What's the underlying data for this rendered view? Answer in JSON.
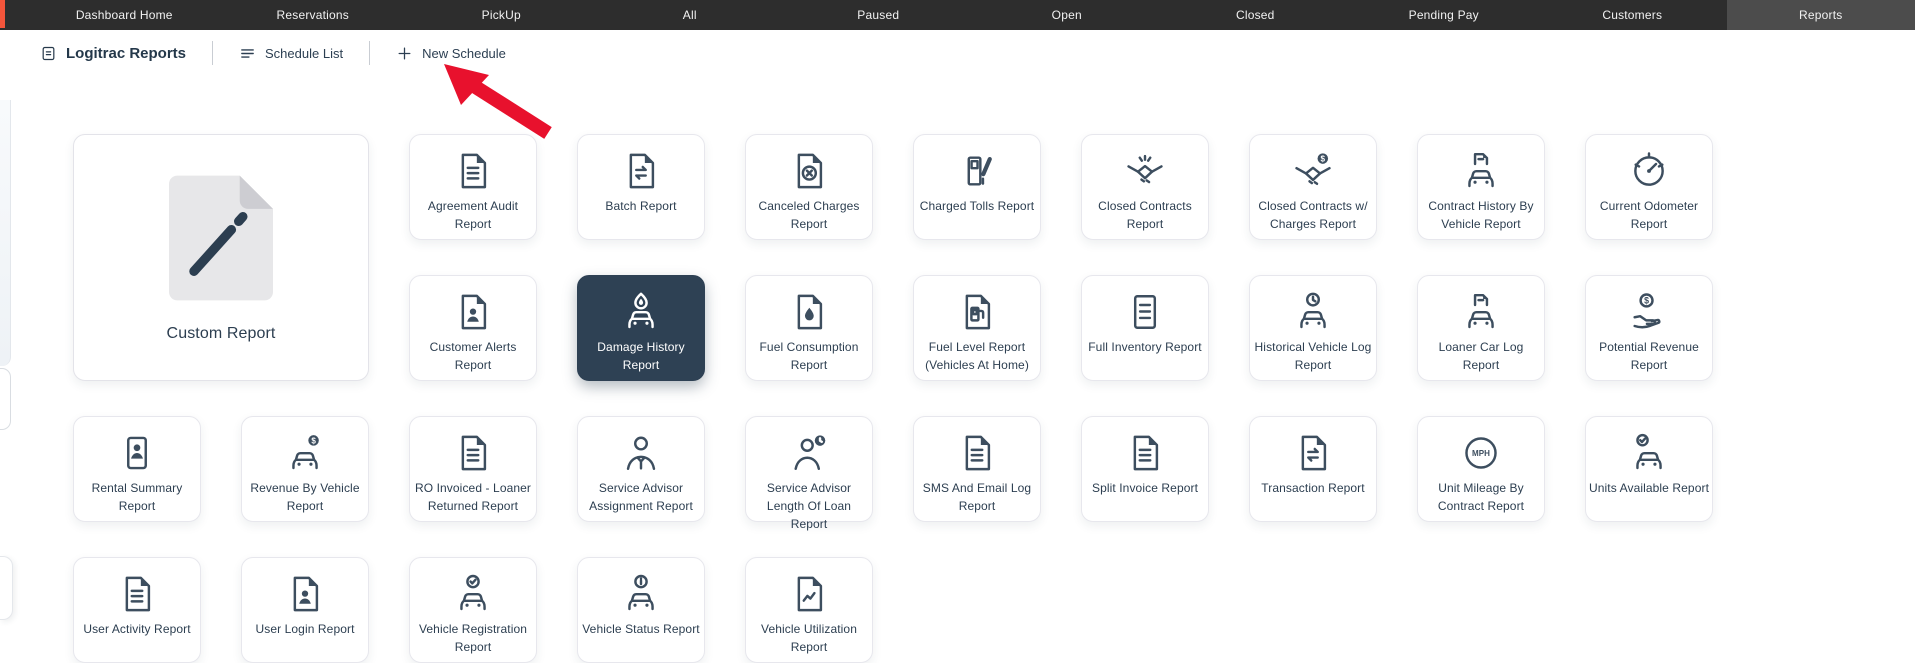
{
  "nav": {
    "items": [
      {
        "label": "Dashboard Home",
        "active": false
      },
      {
        "label": "Reservations",
        "active": false
      },
      {
        "label": "PickUp",
        "active": false
      },
      {
        "label": "All",
        "active": false
      },
      {
        "label": "Paused",
        "active": false
      },
      {
        "label": "Open",
        "active": false
      },
      {
        "label": "Closed",
        "active": false
      },
      {
        "label": "Pending Pay",
        "active": false
      },
      {
        "label": "Customers",
        "active": false
      },
      {
        "label": "Reports",
        "active": true
      }
    ]
  },
  "toolbar": {
    "title": "Logitrac Reports",
    "title_icon": "report-icon",
    "schedule_list_label": "Schedule List",
    "new_schedule_label": "New Schedule",
    "annotation": {
      "shape": "arrow",
      "points_to": "New Schedule",
      "color": "#e8112d"
    }
  },
  "custom_report": {
    "label": "Custom Report",
    "icon": "custom-document"
  },
  "report_rows": [
    [
      {
        "label": "Agreement Audit Report",
        "icon": "doc-lines"
      },
      {
        "label": "Batch Report",
        "icon": "doc-arrows"
      },
      {
        "label": "Canceled Charges Report",
        "icon": "doc-x"
      },
      {
        "label": "Charged Tolls Report",
        "icon": "toll-booth"
      },
      {
        "label": "Closed Contracts Report",
        "icon": "handshake"
      },
      {
        "label": "Closed Contracts w/ Charges Report",
        "icon": "handshake-dollar"
      },
      {
        "label": "Contract History By Vehicle Report",
        "icon": "car-document"
      },
      {
        "label": "Current Odometer Report",
        "icon": "odometer-gauge"
      }
    ],
    [
      {
        "label": "Customer Alerts Report",
        "icon": "doc-person"
      },
      {
        "label": "Damage History Report",
        "icon": "car-flame",
        "selected": true
      },
      {
        "label": "Fuel Consumption Report",
        "icon": "doc-droplet"
      },
      {
        "label": "Fuel Level Report (Vehicles At Home)",
        "icon": "doc-fuel-pump"
      },
      {
        "label": "Full Inventory Report",
        "icon": "doc-lines-boxed"
      },
      {
        "label": "Historical Vehicle Log Report",
        "icon": "car-clock"
      },
      {
        "label": "Loaner Car Log Report",
        "icon": "car-document"
      },
      {
        "label": "Potential Revenue Report",
        "icon": "hand-coin"
      }
    ],
    [
      {
        "label": "Rental Summary Report",
        "icon": "id-card-person"
      },
      {
        "label": "Revenue By Vehicle Report",
        "icon": "car-coin"
      },
      {
        "label": "RO Invoiced - Loaner Returned Report",
        "icon": "doc-lines"
      },
      {
        "label": "Service Advisor Assignment Report",
        "icon": "person-tie"
      },
      {
        "label": "Service Advisor Length Of Loan Report",
        "icon": "person-clock"
      },
      {
        "label": "SMS And Email Log Report",
        "icon": "doc-lines"
      },
      {
        "label": "Split Invoice Report",
        "icon": "doc-lines"
      },
      {
        "label": "Transaction Report",
        "icon": "doc-arrows"
      },
      {
        "label": "Unit Mileage By Contract Report",
        "icon": "mph-circle"
      },
      {
        "label": "Units Available Report",
        "icon": "car-check"
      }
    ],
    [
      {
        "label": "User Activity Report",
        "icon": "doc-lines"
      },
      {
        "label": "User Login Report",
        "icon": "doc-person"
      },
      {
        "label": "Vehicle Registration Report",
        "icon": "car-check-top"
      },
      {
        "label": "Vehicle Status Report",
        "icon": "car-info-top"
      },
      {
        "label": "Vehicle Utilization Report",
        "icon": "doc-chart"
      }
    ]
  ],
  "colors": {
    "nav_bg": "#2d2d2d",
    "nav_active_bg": "#4c4c4c",
    "accent_red": "#e8112d",
    "orange_strip": "#f4553b",
    "selected_card_bg": "#2e4154",
    "icon_color": "#3d4e5f",
    "text_navy": "#2c3e50"
  }
}
